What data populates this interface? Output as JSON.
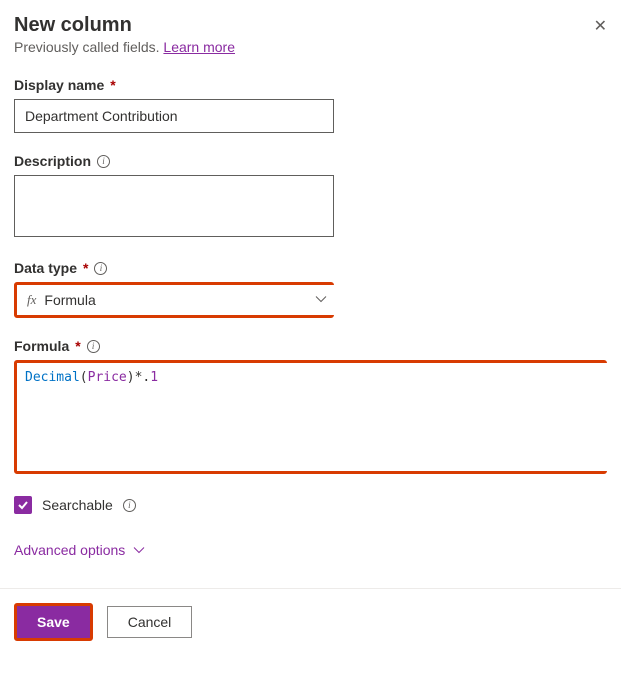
{
  "header": {
    "title": "New column",
    "subtitle_prefix": "Previously called fields. ",
    "learn_more": "Learn more"
  },
  "fields": {
    "display_name": {
      "label": "Display name",
      "value": "Department Contribution"
    },
    "description": {
      "label": "Description",
      "value": ""
    },
    "data_type": {
      "label": "Data type",
      "fx": "fx",
      "value": "Formula"
    },
    "formula": {
      "label": "Formula",
      "tokens": {
        "fn": "Decimal",
        "open": "(",
        "arg": "Price",
        "close": ")",
        "op": "*.",
        "num": "1"
      }
    },
    "searchable": {
      "label": "Searchable",
      "checked": true
    }
  },
  "advanced": "Advanced options",
  "footer": {
    "save": "Save",
    "cancel": "Cancel"
  }
}
